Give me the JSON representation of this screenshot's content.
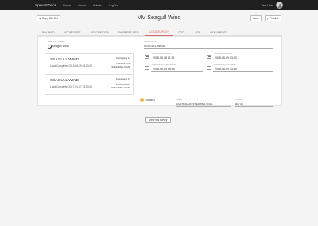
{
  "nav": {
    "brand": "SpeedEDocs",
    "links": [
      "Home",
      "About",
      "Admin",
      "LogOut"
    ],
    "username": "Test User"
  },
  "toolbar": {
    "copy_label": "Copy Bill Set",
    "save_label": "Save",
    "finalise_label": "Finalise"
  },
  "page": {
    "title": "MV Seagull Wind"
  },
  "tabs": [
    "BOL INFO",
    "ADDRESSEE",
    "DESCRIPTION",
    "SHIPPERS DECL",
    "LOAD SURVEY",
    "COCL",
    "SOF",
    "DOCUMENTS"
  ],
  "active_tab": "LOAD SURVEY",
  "search": {
    "label": "Search for Vessel",
    "value": "Seagull Wind"
  },
  "surveys": [
    {
      "name": "SEAGULL WIND",
      "sub": "Load Complete: 2018-08-09 03:03:00",
      "port": "Kooragang 11",
      "shipper1": "AUSTRALIAN",
      "shipper2": "STEAMING COAL"
    },
    {
      "name": "SEAGULL WIND",
      "sub": "Load Complete: 2017-01-07 15:53:00",
      "port": "Kooragang 11",
      "shipper1": "AUSTRALIAN",
      "shipper2": "STEAMING COAL"
    }
  ],
  "detail": {
    "vessel_label": "Vessel Name",
    "vessel_value": "SEAGULL WIND",
    "commence_label": "Commenced Loading",
    "commence_value": "2018-08-08 11:36",
    "complete_label": "Completed Loading",
    "complete_value": "2018-08-09 03:03",
    "survey_label": "Load Survey Commenced",
    "survey_value": "2018-08-09 06:15",
    "survey_done_label": "Load Survey Completed",
    "survey_done_value": "2018-08-09 03:15",
    "grade_label": "Grade 1",
    "name_label": "Name",
    "name_value": "AUSTRALIAN STEAMING COAL",
    "tonnes_label": "Tonnes",
    "tonnes_value": "80736"
  },
  "view_button": "View this survey"
}
